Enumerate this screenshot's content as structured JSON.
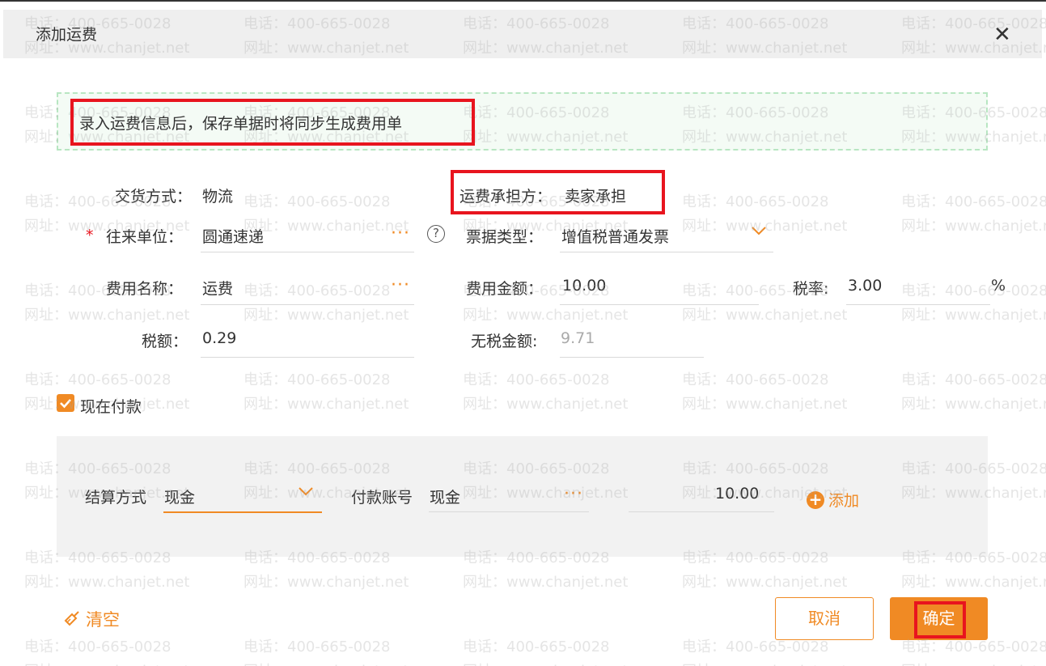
{
  "dialog": {
    "title": "添加运费",
    "close_glyph": "✕"
  },
  "notice": {
    "text": "录入运费信息后，保存单据时将同步生成费用单"
  },
  "form": {
    "delivery_label": "交货方式：",
    "delivery_value": "物流",
    "bearer_label": "运费承担方：",
    "bearer_value": "卖家承担",
    "required_mark": "*",
    "partner_label": "往来单位：",
    "partner_value": "圆通速递",
    "help_glyph": "?",
    "invoice_label": "票据类型：",
    "invoice_value": "增值税普通发票",
    "fee_name_label": "费用名称：",
    "fee_name_value": "运费",
    "fee_amount_label": "费用金额：",
    "fee_amount_value": "10.00",
    "tax_rate_label": "税率:",
    "tax_rate_value": "3.00",
    "tax_rate_unit": "%",
    "tax_label": "税额：",
    "tax_value": "0.29",
    "untaxed_label": "无税金额:",
    "untaxed_value": "9.71",
    "ellipsis": "···"
  },
  "pay_now": {
    "checked": true,
    "label": "现在付款"
  },
  "payment": {
    "method_label": "结算方式",
    "method_value": "现金",
    "account_label": "付款账号",
    "account_value": "现金",
    "amount_value": "10.00",
    "add_glyph": "+",
    "add_label": "添加"
  },
  "footer": {
    "clear_label": "清空",
    "cancel_label": "取消",
    "ok_label": "确定"
  },
  "watermark": {
    "phone": "电话：400-665-0028",
    "site": "网址：www.chanjet.net"
  },
  "colors": {
    "accent": "#f08a24",
    "highlight_box": "#e8141e",
    "notice_border": "#b8e6c2"
  }
}
